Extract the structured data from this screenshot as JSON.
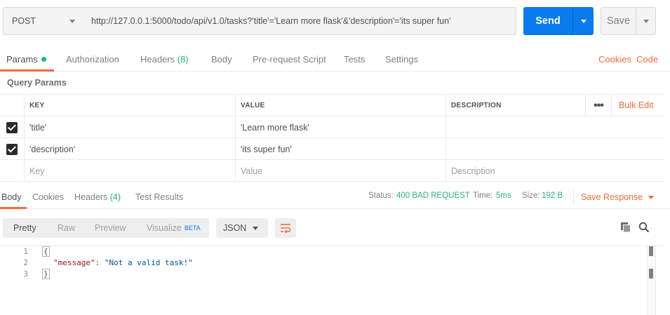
{
  "request": {
    "method": "POST",
    "url": "http://127.0.0.1:5000/todo/api/v1.0/tasks?'title'='Learn more flask'&'description'='its super fun'",
    "send_label": "Send",
    "save_label": "Save"
  },
  "request_tabs": {
    "params": "Params",
    "authorization": "Authorization",
    "headers": "Headers",
    "headers_count": "(8)",
    "body": "Body",
    "prerequest": "Pre-request Script",
    "tests": "Tests",
    "settings": "Settings",
    "cookies": "Cookies",
    "code": "Code"
  },
  "query_params": {
    "title": "Query Params",
    "headers": {
      "key": "KEY",
      "value": "VALUE",
      "description": "DESCRIPTION"
    },
    "bulk_edit": "Bulk Edit",
    "rows": [
      {
        "key": "'title'",
        "value": "'Learn more flask'",
        "description": ""
      },
      {
        "key": "'description'",
        "value": "'its super fun'",
        "description": ""
      }
    ],
    "placeholders": {
      "key": "Key",
      "value": "Value",
      "description": "Description"
    }
  },
  "response_tabs": {
    "body": "Body",
    "cookies": "Cookies",
    "headers": "Headers",
    "headers_count": "(4)",
    "test_results": "Test Results"
  },
  "response_status": {
    "status_label": "Status:",
    "status_value": "400 BAD REQUEST",
    "time_label": "Time:",
    "time_value": "5ms",
    "size_label": "Size:",
    "size_value": "192 B",
    "save_response": "Save Response"
  },
  "response_view": {
    "pretty": "Pretty",
    "raw": "Raw",
    "preview": "Preview",
    "visualize": "Visualize",
    "beta": "BETA",
    "format": "JSON"
  },
  "response_body": {
    "line_numbers": [
      "1",
      "2",
      "3"
    ],
    "open_brace": "{",
    "key": "\"message\"",
    "colon": ": ",
    "value": "\"Not a valid task!\"",
    "close_brace": "}"
  },
  "colors": {
    "accent": "#f26b3a",
    "primary": "#097bed",
    "success": "#26b47f"
  },
  "icons": [
    "chevron-down-icon",
    "text-wrap-icon",
    "copy-icon",
    "search-icon",
    "more-dots-icon",
    "checkbox-checked-icon"
  ]
}
